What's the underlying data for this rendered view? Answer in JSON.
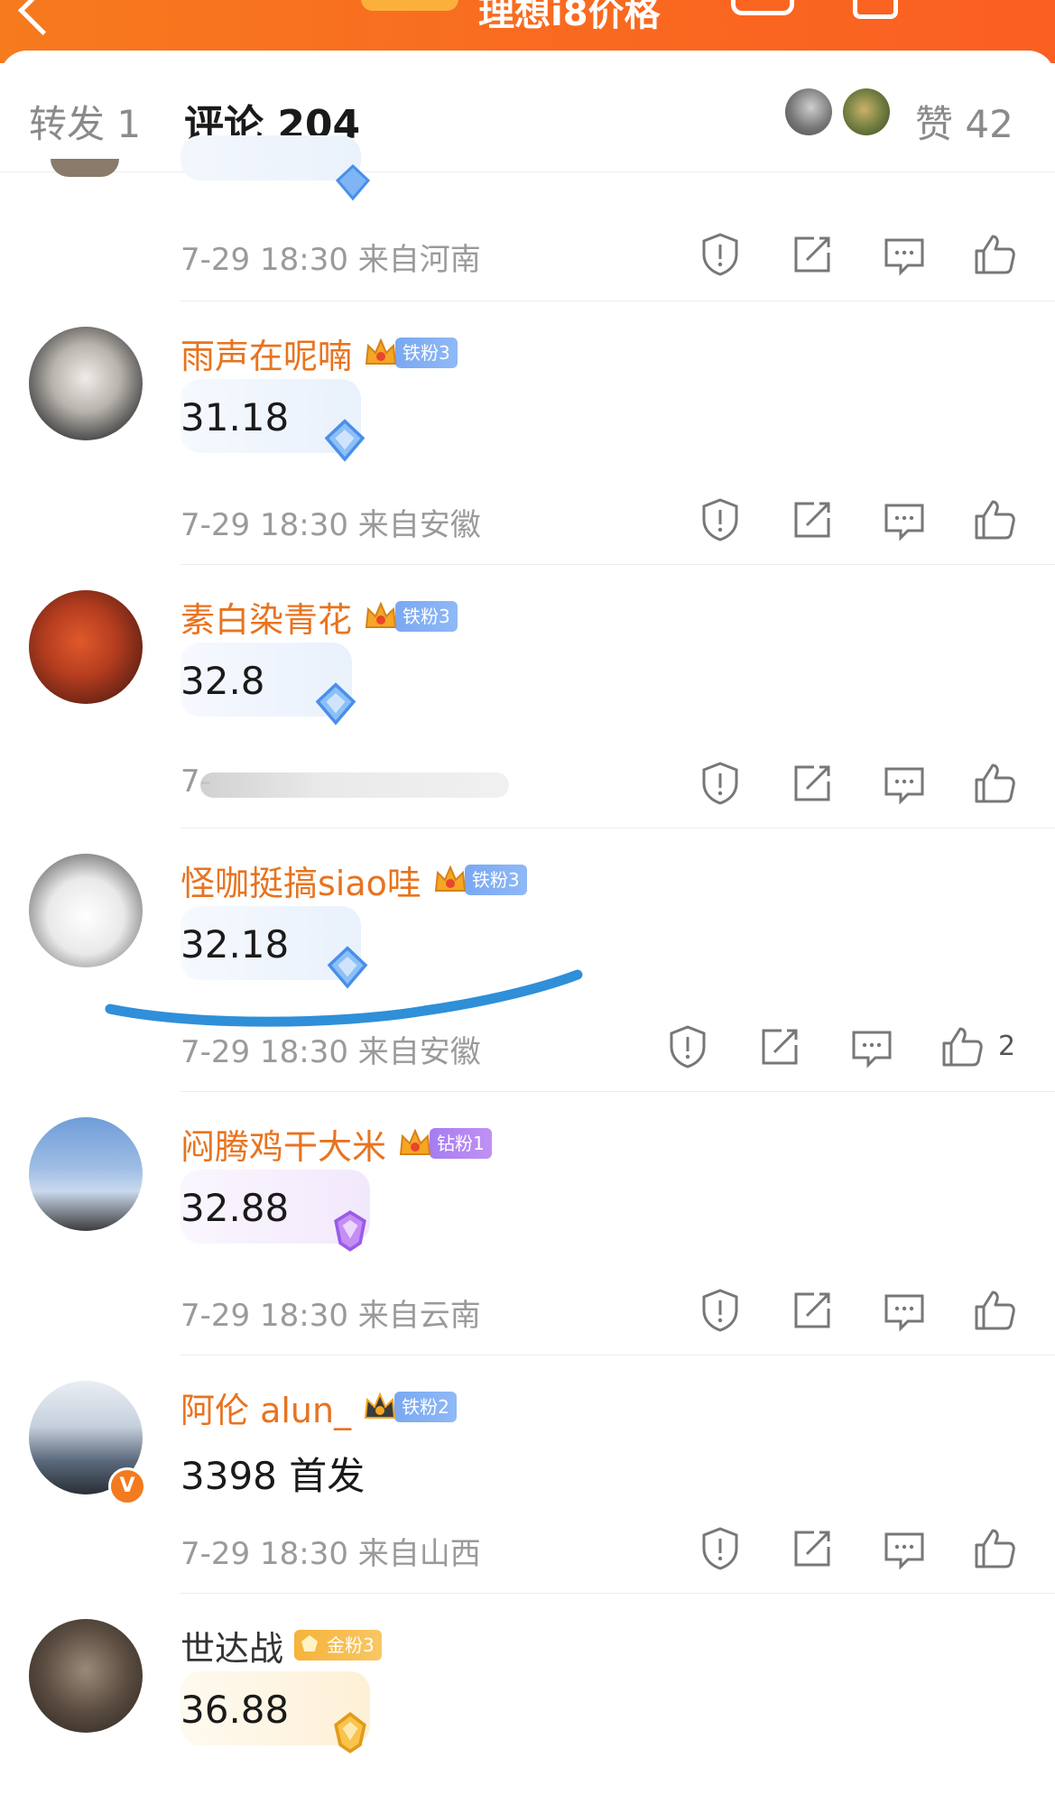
{
  "header": {
    "title": "理想i8价格"
  },
  "tabs": {
    "repost": "转发 1",
    "comments": "评论 204",
    "likes": "赞 42"
  },
  "colors": {
    "accent": "#f7781f",
    "username": "#e8731f",
    "meta": "#9a9a9a",
    "underline_annotation": "#2f8fd8"
  },
  "top_partial_comment": {
    "meta": "7-29 18:30 来自河南"
  },
  "comments": [
    {
      "name": "雨声在呢喃",
      "badge": "铁粉3",
      "badge_color": "blue",
      "text": "31.18",
      "meta": "7-29 18:30 来自安徽",
      "likes": ""
    },
    {
      "name": "素白染青花",
      "badge": "铁粉3",
      "badge_color": "blue",
      "text": "32.8",
      "meta": "7-",
      "likes": ""
    },
    {
      "name": "怪咖挺搞siao哇",
      "badge": "铁粉3",
      "badge_color": "blue",
      "text": "32.18",
      "meta": "7-29 18:30 来自安徽",
      "likes": "2"
    },
    {
      "name": "闷腾鸡干大米",
      "badge": "钻粉1",
      "badge_color": "purple",
      "text": "32.88",
      "meta": "7-29 18:30 来自云南",
      "likes": ""
    },
    {
      "name": "阿伦 alun_",
      "badge": "铁粉2",
      "badge_color": "blue",
      "text": "3398 首发",
      "meta": "7-29 18:30 来自山西",
      "likes": ""
    },
    {
      "name": "世达战",
      "badge": "金粉3",
      "badge_color": "gold",
      "text": "36.88",
      "meta": "",
      "likes": ""
    }
  ],
  "icons": [
    "report-icon",
    "repost-icon",
    "reply-icon",
    "thumbs-up-icon",
    "crown-icon",
    "diamond-gem-icon",
    "verified-icon",
    "back-icon"
  ]
}
